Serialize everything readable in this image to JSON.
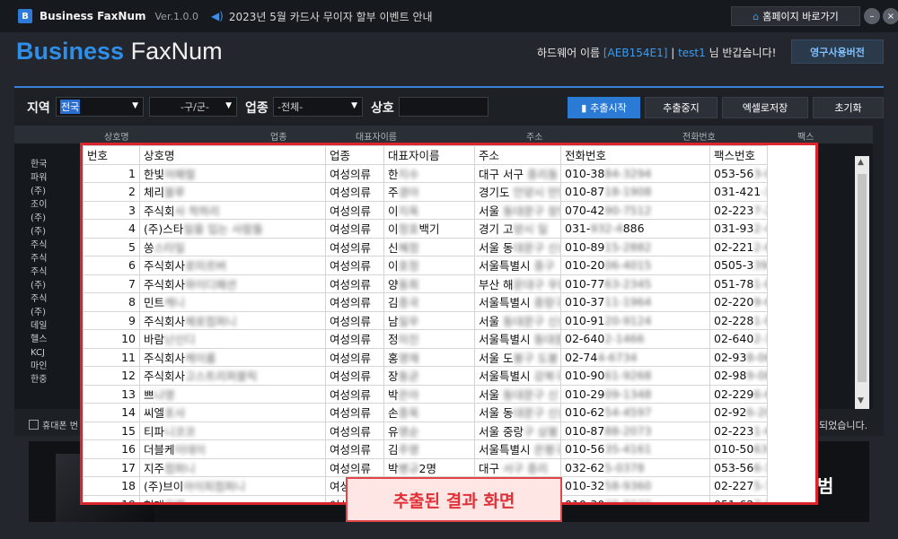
{
  "titlebar": {
    "logo_letter": "B",
    "app_name": "Business FaxNum",
    "version": "Ver.1.0.0",
    "notice": "2023년 5월 카드사 무이자 할부 이벤트 안내",
    "home_button": "홈페이지 바로가기",
    "minimize": "–",
    "close": "×"
  },
  "header": {
    "brand_bold": "Business",
    "brand_light": "FaxNum",
    "hw_prefix": "하드웨어 이름 ",
    "hw_id": "[AEB154E1]",
    "hw_sep": " | ",
    "user": "test1",
    "hw_suffix": " 님 반갑습니다!",
    "perm_button": "영구사용버전"
  },
  "filters": {
    "region_label": "지역",
    "region_value": "전국",
    "district_value": "-구/군-",
    "industry_label": "업종",
    "industry_value": "-전체-",
    "name_label": "상호",
    "name_value": ""
  },
  "buttons": {
    "extract_start": "추출시작",
    "extract_stop": "추출중지",
    "excel_save": "엑셀로저장",
    "reset": "초기화"
  },
  "bg_table": {
    "headers": [
      "상호명",
      "업종",
      "대표자이름",
      "주소",
      "전화번호",
      "팩스"
    ],
    "rows": [
      "한국",
      "파워",
      "(주)",
      "조이",
      "(주)",
      "(주)",
      "주식",
      "주식",
      "주식",
      "(주)",
      "주식",
      "(주)",
      "데일",
      "헬스",
      "KCJ",
      "마인",
      "한중"
    ]
  },
  "checkbox_label": "휴대폰 번",
  "done_text": "되었습니다.",
  "promo_tail": "범",
  "results": {
    "headers": [
      "번호",
      "상호명",
      "업종",
      "대표자이름",
      "주소",
      "전화번호",
      "팩스번호"
    ],
    "rows": [
      {
        "no": "1",
        "name": "한빛",
        "name_blur": "어패럴",
        "ind": "여성의류",
        "rep": "한",
        "rep_blur": "지수",
        "addr": "대구 서구",
        "addr_blur": " 중리동",
        "tel": "010-38",
        "tel_blur": "84-3294",
        "fax": "053-56",
        "fax_blur": "3-0022"
      },
      {
        "no": "2",
        "name": "체리",
        "name_blur": "블루",
        "ind": "여성의류",
        "rep": "주",
        "rep_blur": "경아",
        "addr": "경기도",
        "addr_blur": " 안양시 만안",
        "tel": "010-87",
        "tel_blur": "18-1908",
        "fax": "031-421",
        "fax_blur": "-1840"
      },
      {
        "no": "3",
        "name": "주식회",
        "name_blur": "사 착하리",
        "ind": "여성의류",
        "rep": "이",
        "rep_blur": "지옥",
        "addr": "서울",
        "addr_blur": " 동대문구 장안",
        "tel": "070-42",
        "tel_blur": "90-7512",
        "fax": "02-223",
        "fax_blur": "7-2460"
      },
      {
        "no": "4",
        "name": "(주)스타",
        "name_blur": "일을 입는 사람들",
        "ind": "여성의류",
        "rep": "이",
        "rep_blur": "정호",
        "rep_tail": "백기",
        "addr": "경기 고",
        "addr_blur": "양시 일",
        "tel": "031-",
        "tel_blur": "932-4",
        "tel_tail": "886",
        "fax": "031-93",
        "fax_blur": "2-4287"
      },
      {
        "no": "5",
        "name": "쏭",
        "name_blur": "스타일",
        "ind": "여성의류",
        "rep": "신",
        "rep_blur": "혜정",
        "addr": "서울 동",
        "addr_blur": "대문구 신설",
        "tel": "010-89",
        "tel_blur": "15-2882",
        "fax": "02-221",
        "fax_blur": "2-6626"
      },
      {
        "no": "6",
        "name": "주식회사",
        "name_blur": "로미르버",
        "ind": "여성의류",
        "rep": "이",
        "rep_blur": "호정",
        "addr": "서울특별시",
        "addr_blur": " 중구",
        "tel": "010-20",
        "tel_blur": "06-4015",
        "fax": "0505-3",
        "fax_blur": "39-1199"
      },
      {
        "no": "7",
        "name": "주식회사",
        "name_blur": "와이디패션",
        "ind": "여성의류",
        "rep": "양",
        "rep_blur": "동희",
        "addr": "부산 해",
        "addr_blur": "운대구 우동",
        "tel": "010-77",
        "tel_blur": "63-2345",
        "fax": "051-78",
        "fax_blur": "1-8345"
      },
      {
        "no": "8",
        "name": "민트",
        "name_blur": "캐니",
        "ind": "여성의류",
        "rep": "김",
        "rep_blur": "종국",
        "addr": "서울특별시",
        "addr_blur": " 중랑구",
        "tel": "010-37",
        "tel_blur": "11-1964",
        "fax": "02-220",
        "fax_blur": "9-6644"
      },
      {
        "no": "9",
        "name": "주식회사",
        "name_blur": "제로컴퍼니",
        "ind": "여성의류",
        "rep": "남",
        "rep_blur": "일우",
        "addr": "서울",
        "addr_blur": " 동대문구 신설",
        "tel": "010-91",
        "tel_blur": "20-9124",
        "fax": "02-228",
        "fax_blur": "1-8070"
      },
      {
        "no": "10",
        "name": "바람",
        "name_blur": "난신디",
        "ind": "여성의류",
        "rep": "정",
        "rep_blur": "미진",
        "addr": "서울특별시",
        "addr_blur": " 동대문구",
        "tel": "02-640",
        "tel_blur": "2-1466",
        "fax": "02-640",
        "fax_blur": "2-1468"
      },
      {
        "no": "11",
        "name": "주식회사",
        "name_blur": "케이룸",
        "ind": "여성의류",
        "rep": "홍",
        "rep_blur": "영재",
        "addr": "서울 도",
        "addr_blur": "봉구 도봉",
        "tel": "02-74",
        "tel_blur": "4-6734",
        "fax": "02-93",
        "fax_blur": "8-0678"
      },
      {
        "no": "12",
        "name": "주식회사",
        "name_blur": "고스트리퍼블릭",
        "ind": "여성의류",
        "rep": "장",
        "rep_blur": "동균",
        "addr": "서울특별시",
        "addr_blur": " 강북구",
        "tel": "010-90",
        "tel_blur": "61-9268",
        "fax": "02-98",
        "fax_blur": "9-0890"
      },
      {
        "no": "13",
        "name": "쁘",
        "name_blur": "나영",
        "ind": "여성의류",
        "rep": "박",
        "rep_blur": "은아",
        "addr": "서울",
        "addr_blur": " 동대문구 신",
        "tel": "010-29",
        "tel_blur": "09-1348",
        "fax": "02-229",
        "fax_blur": "6-6128"
      },
      {
        "no": "14",
        "name": "씨엘",
        "name_blur": "포샤",
        "ind": "여성의류",
        "rep": "손",
        "rep_blur": "종옥",
        "addr": "서울 동",
        "addr_blur": "대문구 신설",
        "tel": "010-62",
        "tel_blur": "54-4597",
        "fax": "02-92",
        "fax_blur": "6-2055"
      },
      {
        "no": "15",
        "name": "티파",
        "name_blur": "니코코",
        "ind": "여성의류",
        "rep": "유",
        "rep_blur": "영순",
        "addr": "서울 중랑",
        "addr_blur": "구 상봉",
        "tel": "010-87",
        "tel_blur": "88-2073",
        "fax": "02-223",
        "fax_blur": "1-6361"
      },
      {
        "no": "16",
        "name": "더블케",
        "name_blur": "이데이",
        "ind": "여성의류",
        "rep": "김",
        "rep_blur": "주영",
        "addr": "서울특별시",
        "addr_blur": " 은평구",
        "tel": "010-56",
        "tel_blur": "35-4161",
        "fax": "010-50",
        "fax_blur": "63-0107"
      },
      {
        "no": "17",
        "name": "지주",
        "name_blur": "컴퍼니",
        "ind": "여성의류",
        "rep": "박",
        "rep_blur": "병규",
        "rep_tail": "2명",
        "addr": "대구",
        "addr_blur": " 서구 중리",
        "tel": "032-62",
        "tel_blur": "5-0378",
        "fax": "053-56",
        "fax_blur": "6-1988"
      },
      {
        "no": "18",
        "name": "(주)브이",
        "name_blur": "아이피컴퍼니",
        "ind": "여성의류",
        "rep": "",
        "rep_blur": "김은",
        "addr": "",
        "addr_blur": "서울 중구",
        "tel": "010-32",
        "tel_blur": "58-9360",
        "fax": "02-227",
        "fax_blur": "5-7736"
      },
      {
        "no": "19",
        "name": "현대",
        "name_blur": "유백",
        "ind": "여성",
        "rep": "",
        "rep_blur": "",
        "addr": "",
        "addr_blur": "",
        "tel": "010-30",
        "tel_blur": "29-8030",
        "fax": "051-62",
        "fax_blur": "7-9849"
      }
    ]
  },
  "caption": "추출된 결과 화면"
}
